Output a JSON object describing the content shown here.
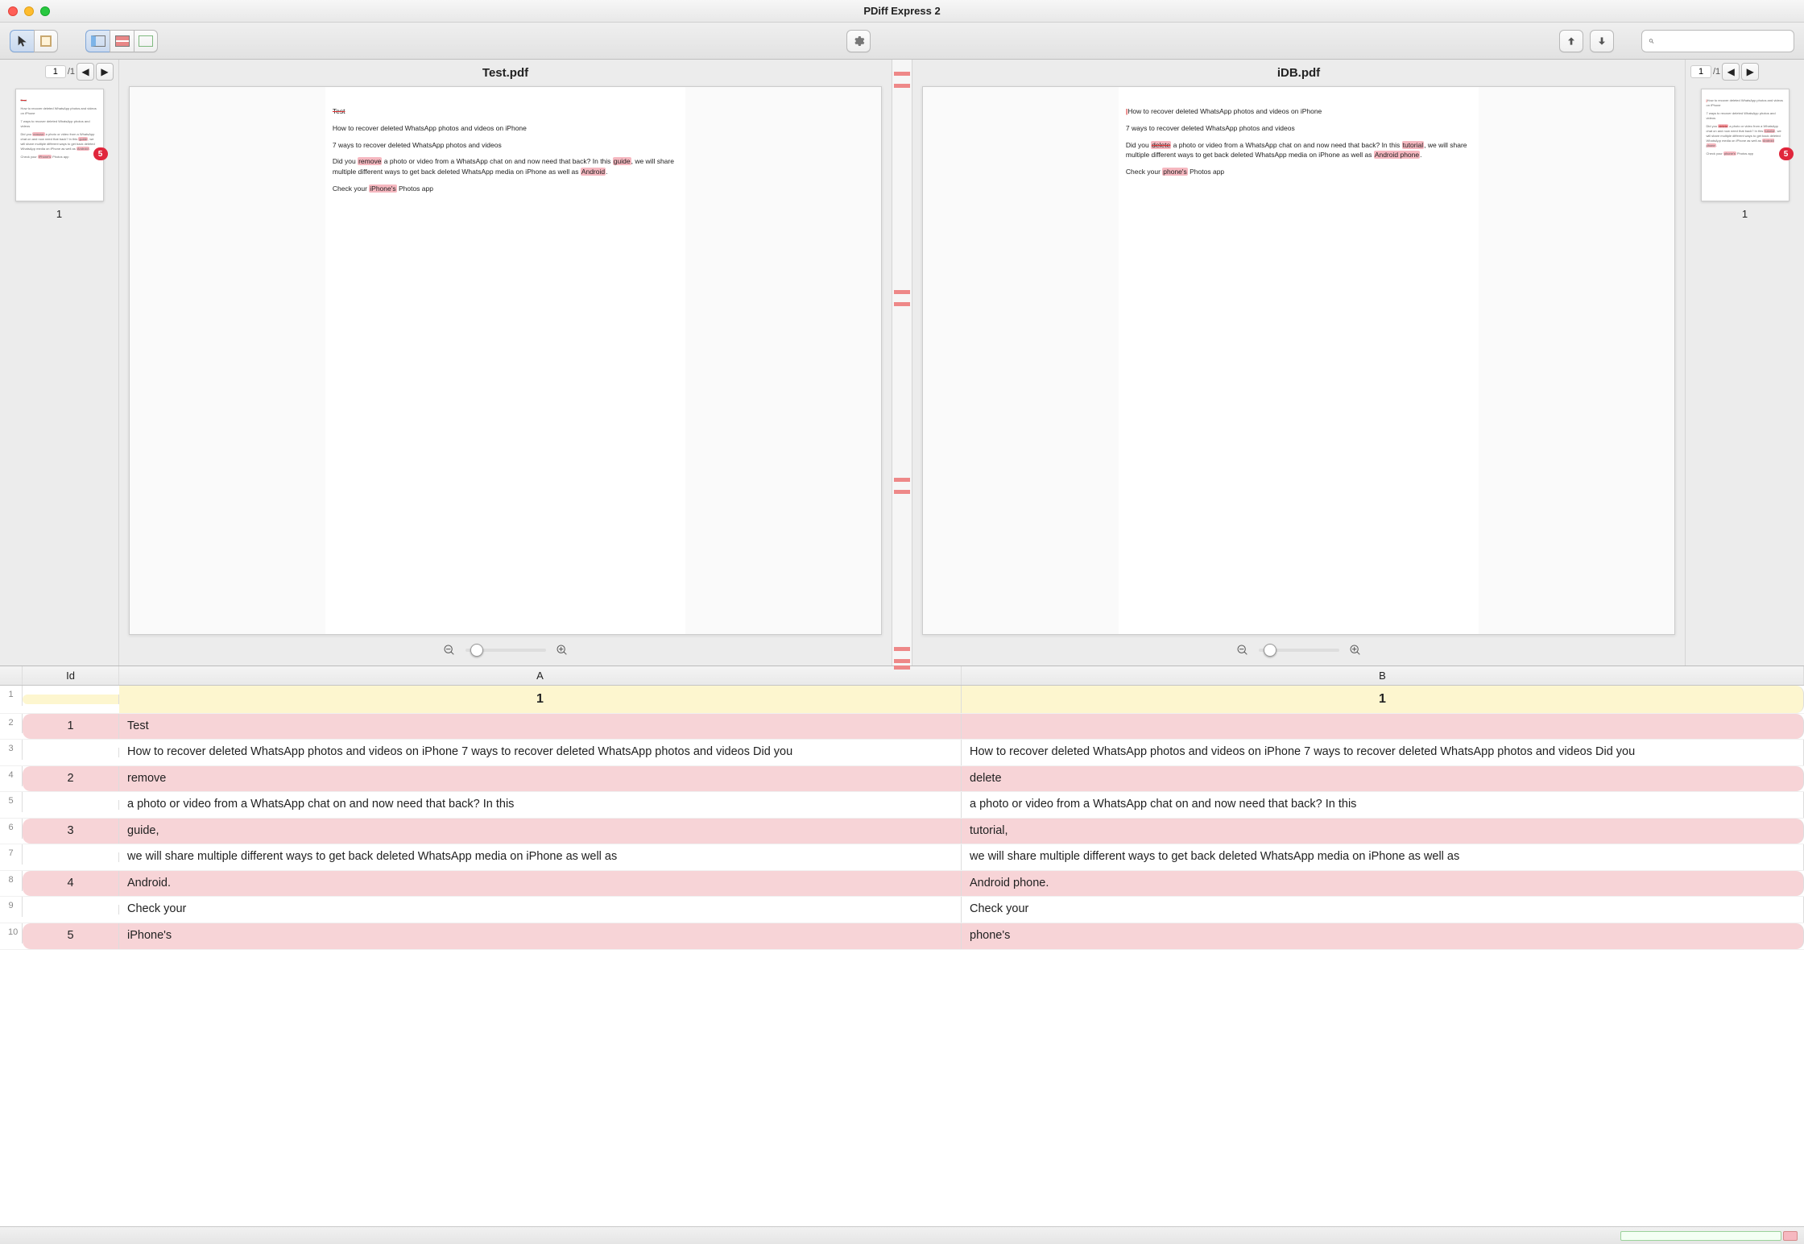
{
  "window": {
    "title": "PDiff Express 2"
  },
  "toolbar": {
    "cursor": "cursor-tool",
    "select": "rect-select-tool",
    "views": [
      "split-view",
      "overlay-view",
      "single-view"
    ],
    "settings": "settings",
    "prev": "↑",
    "next": "↓",
    "searchPlaceholder": ""
  },
  "pager": {
    "page": "1",
    "total": "/1"
  },
  "docA": {
    "name": "Test.pdf",
    "lines": [
      {
        "text": "Test",
        "diff": "del"
      },
      {
        "text": "How to recover deleted WhatsApp photos and videos on iPhone"
      },
      {
        "text": "7 ways to recover deleted WhatsApp photos and videos"
      },
      {
        "parts": [
          {
            "t": "Did you "
          },
          {
            "t": "remove",
            "d": "hl"
          },
          {
            "t": " a photo or video from a WhatsApp chat on and now need that back? In this "
          },
          {
            "t": "guide",
            "d": "hl"
          },
          {
            "t": ", we will share multiple different ways to get back deleted WhatsApp media on iPhone as well as "
          },
          {
            "t": "Android",
            "d": "hl"
          },
          {
            "t": "."
          }
        ]
      },
      {
        "parts": [
          {
            "t": "Check your "
          },
          {
            "t": "iPhone's",
            "d": "hl"
          },
          {
            "t": " Photos app"
          }
        ]
      }
    ],
    "badge": "5",
    "thumbLabel": "1"
  },
  "docB": {
    "name": "iDB.pdf",
    "lines": [
      {
        "parts": [
          {
            "t": "",
            "d": "ins"
          },
          {
            "t": "How to recover deleted WhatsApp photos and videos on iPhone"
          }
        ]
      },
      {
        "text": "7 ways to recover deleted WhatsApp photos and videos"
      },
      {
        "parts": [
          {
            "t": "Did you "
          },
          {
            "t": "delete",
            "d": "hl del"
          },
          {
            "t": " a photo or video from a WhatsApp chat on and now need that back? In this "
          },
          {
            "t": "tutorial",
            "d": "hl"
          },
          {
            "t": ", we will share multiple different ways to get back deleted WhatsApp media on iPhone as well as "
          },
          {
            "t": "Android phone",
            "d": "hl"
          },
          {
            "t": "."
          }
        ]
      },
      {
        "parts": [
          {
            "t": "Check your "
          },
          {
            "t": "phone's",
            "d": "hl"
          },
          {
            "t": " Photos app"
          }
        ]
      }
    ],
    "badge": "5",
    "thumbLabel": "1"
  },
  "table": {
    "headers": {
      "rn": "",
      "id": "Id",
      "a": "A",
      "b": "B"
    },
    "rows": [
      {
        "rn": "1",
        "id": "",
        "a": "1",
        "b": "1",
        "cls": "yellow"
      },
      {
        "rn": "2",
        "id": "1",
        "a": "Test",
        "b": "",
        "cls": "pink"
      },
      {
        "rn": "3",
        "id": "",
        "a": "How to recover deleted WhatsApp photos and videos on iPhone 7 ways to recover deleted WhatsApp photos and videos Did you",
        "b": "How to recover deleted WhatsApp photos and videos on iPhone 7 ways to recover deleted WhatsApp photos and videos Did you",
        "cls": ""
      },
      {
        "rn": "4",
        "id": "2",
        "a": "remove",
        "b": "delete",
        "cls": "pink"
      },
      {
        "rn": "5",
        "id": "",
        "a": "a photo or video from a WhatsApp chat on and now need that back? In this",
        "b": "a photo or video from a WhatsApp chat on and now need that back? In this",
        "cls": ""
      },
      {
        "rn": "6",
        "id": "3",
        "a": "guide,",
        "b": "tutorial,",
        "cls": "pink"
      },
      {
        "rn": "7",
        "id": "",
        "a": "we will share multiple different ways to get back deleted WhatsApp media on iPhone as well as",
        "b": "we will share multiple different ways to get back deleted WhatsApp media on iPhone as well as",
        "cls": ""
      },
      {
        "rn": "8",
        "id": "4",
        "a": "Android.",
        "b": "Android phone.",
        "cls": "pink"
      },
      {
        "rn": "9",
        "id": "",
        "a": "Check your",
        "b": "Check your",
        "cls": ""
      },
      {
        "rn": "10",
        "id": "5",
        "a": "iPhone's",
        "b": "phone's",
        "cls": "pink"
      }
    ]
  },
  "centerMarks": [
    2,
    4,
    38,
    40,
    69,
    71,
    97,
    99,
    100
  ]
}
